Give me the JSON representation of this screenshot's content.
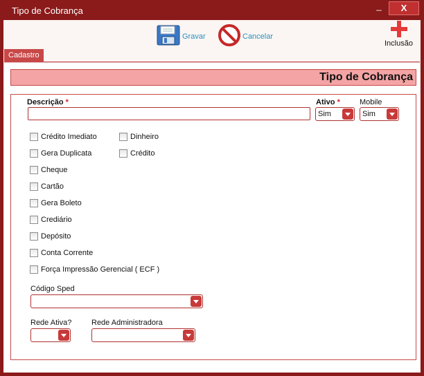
{
  "window": {
    "title": "Tipo de Cobrança",
    "minimize_label": "_",
    "close_label": "X"
  },
  "toolbar": {
    "save_label": "Gravar",
    "cancel_label": "Cancelar",
    "new_label": "Inclusão"
  },
  "tabs": [
    {
      "label": "Cadastro"
    }
  ],
  "form": {
    "header_title": "Tipo de Cobrança",
    "descricao": {
      "label": "Descrição",
      "required_mark": "*",
      "value": ""
    },
    "ativo": {
      "label": "Ativo",
      "required_mark": "*",
      "value": "Sim"
    },
    "mobile": {
      "label": "Mobile",
      "value": "Sim"
    },
    "checkboxes": [
      {
        "label": "Crédito Imediato",
        "checked": false
      },
      {
        "label": "Dinheiro",
        "checked": false
      },
      {
        "label": "Gera Duplicata",
        "checked": false
      },
      {
        "label": "Crédito",
        "checked": false
      },
      {
        "label": "Cheque",
        "checked": false
      },
      {
        "label": "Cartão",
        "checked": false
      },
      {
        "label": "Gera Boleto",
        "checked": false
      },
      {
        "label": "Crediário",
        "checked": false
      },
      {
        "label": "Depósito",
        "checked": false
      },
      {
        "label": "Conta Corrente",
        "checked": false
      },
      {
        "label": "Força Impressão Gerencial ( ECF )",
        "checked": false
      }
    ],
    "codigo_sped": {
      "label": "Código Sped",
      "value": ""
    },
    "rede_ativa": {
      "label": "Rede Ativa?",
      "value": ""
    },
    "rede_administradora": {
      "label": "Rede Administradora",
      "value": ""
    }
  },
  "colors": {
    "window_frame": "#8b1a1a",
    "accent": "#c84848",
    "header_fill": "#f4a4a4",
    "link_blue": "#2a8fc0"
  }
}
